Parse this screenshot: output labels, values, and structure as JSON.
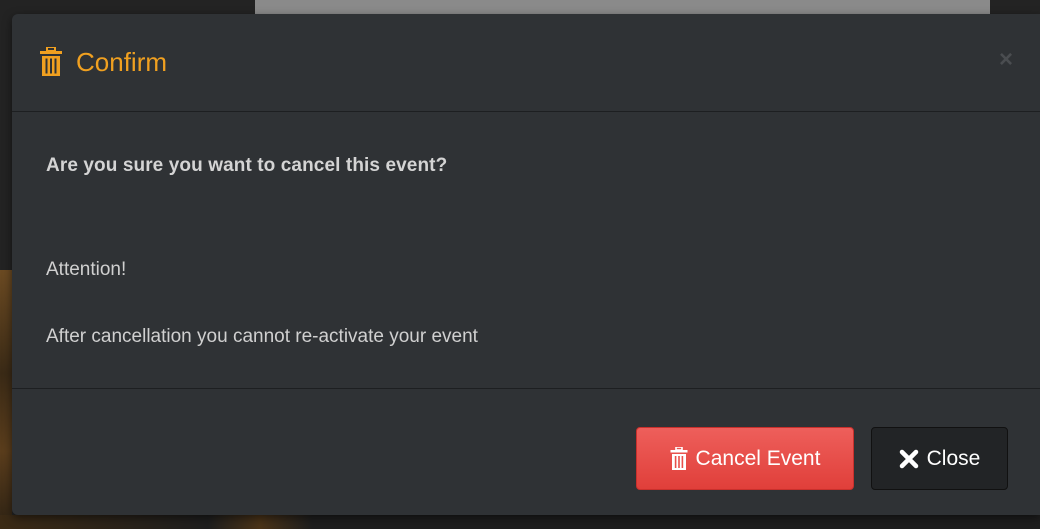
{
  "dialog": {
    "title": "Confirm",
    "title_icon": "trash-icon",
    "close_icon": "close-x-icon",
    "close_glyph": "×",
    "question": "Are you sure you want to cancel this event?",
    "attention": "Attention!",
    "note": "After cancellation you cannot re-activate your event"
  },
  "buttons": {
    "cancel_event": {
      "label": "Cancel Event",
      "icon": "trash-icon"
    },
    "close": {
      "label": "Close",
      "icon": "close-icon"
    }
  },
  "colors": {
    "accent": "#f0a020",
    "danger": "#e8504b",
    "modal_bg": "#2f3235",
    "button_dark": "#222426"
  }
}
